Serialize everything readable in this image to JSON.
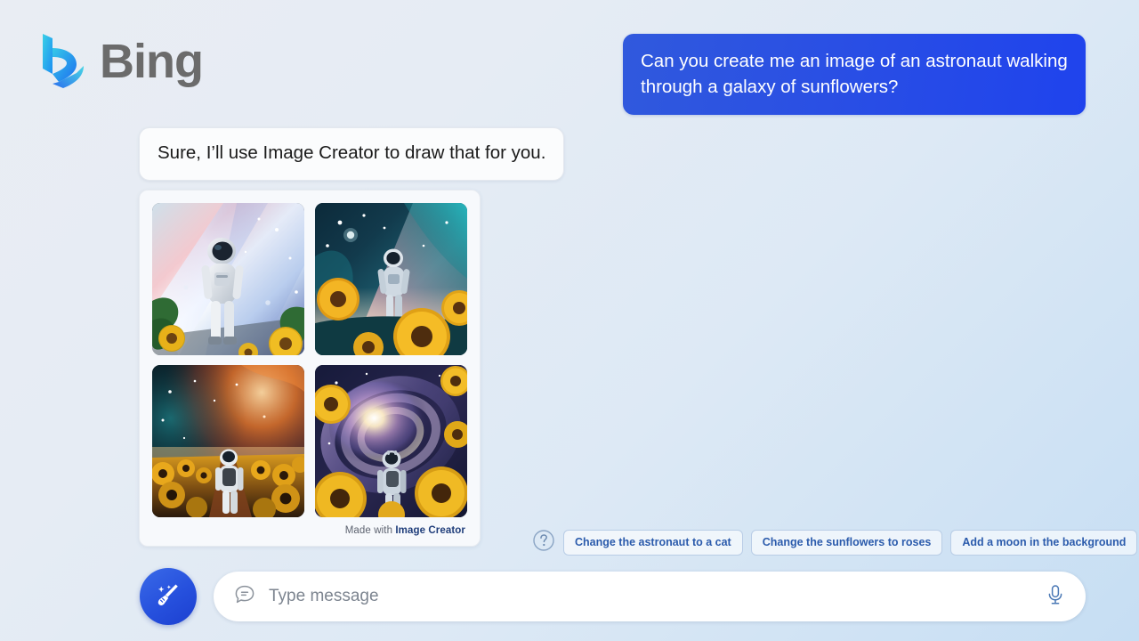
{
  "brand": {
    "name": "Bing",
    "logo_icon": "bing-logo-icon",
    "logo_gradient_start": "#3fd0e8",
    "logo_gradient_end": "#1a7ff0"
  },
  "conversation": {
    "user_message": {
      "text": "Can you create me an image of an astronaut walking through a galaxy of sunflowers?",
      "bubble_color_start": "#3059dd",
      "bubble_color_end": "#1f43ed",
      "text_color": "#ffffff"
    },
    "bot_message": {
      "text": "Sure, I’ll use Image Creator to draw that for you.",
      "bubble_color": "#fbfcfd",
      "text_color": "#1b1b1b"
    }
  },
  "image_results": {
    "images": [
      {
        "alt": "Astronaut standing in bright white and pink nebula with sunflowers and green leaves",
        "name": "generated-image-1"
      },
      {
        "alt": "Astronaut walking through teal and pink galaxy with large golden sunflowers",
        "name": "generated-image-2"
      },
      {
        "alt": "Astronaut walking down a path in a dark sunflower field under an orange nebula",
        "name": "generated-image-3"
      },
      {
        "alt": "Astronaut facing a glowing spiral galaxy framed by yellow sunflowers",
        "name": "generated-image-4"
      }
    ],
    "footer_prefix": "Made with ",
    "footer_brand": "Image Creator",
    "footer_brand_color": "#1f3d7a"
  },
  "suggestions": {
    "help_icon": "question-circle-icon",
    "chips": [
      {
        "label": "Change the astronaut to a cat"
      },
      {
        "label": "Change the sunflowers to roses"
      },
      {
        "label": "Add a moon in the background"
      }
    ],
    "chip_text_color": "#2b5bac",
    "chip_border_color": "#b9cde6"
  },
  "composer": {
    "new_topic_icon": "broom-sparkle-icon",
    "new_topic_color": "#2650dd",
    "message_icon": "chat-bubble-icon",
    "placeholder": "Type message",
    "input_value": "",
    "mic_icon": "microphone-icon",
    "mic_color": "#3a6aa8"
  }
}
